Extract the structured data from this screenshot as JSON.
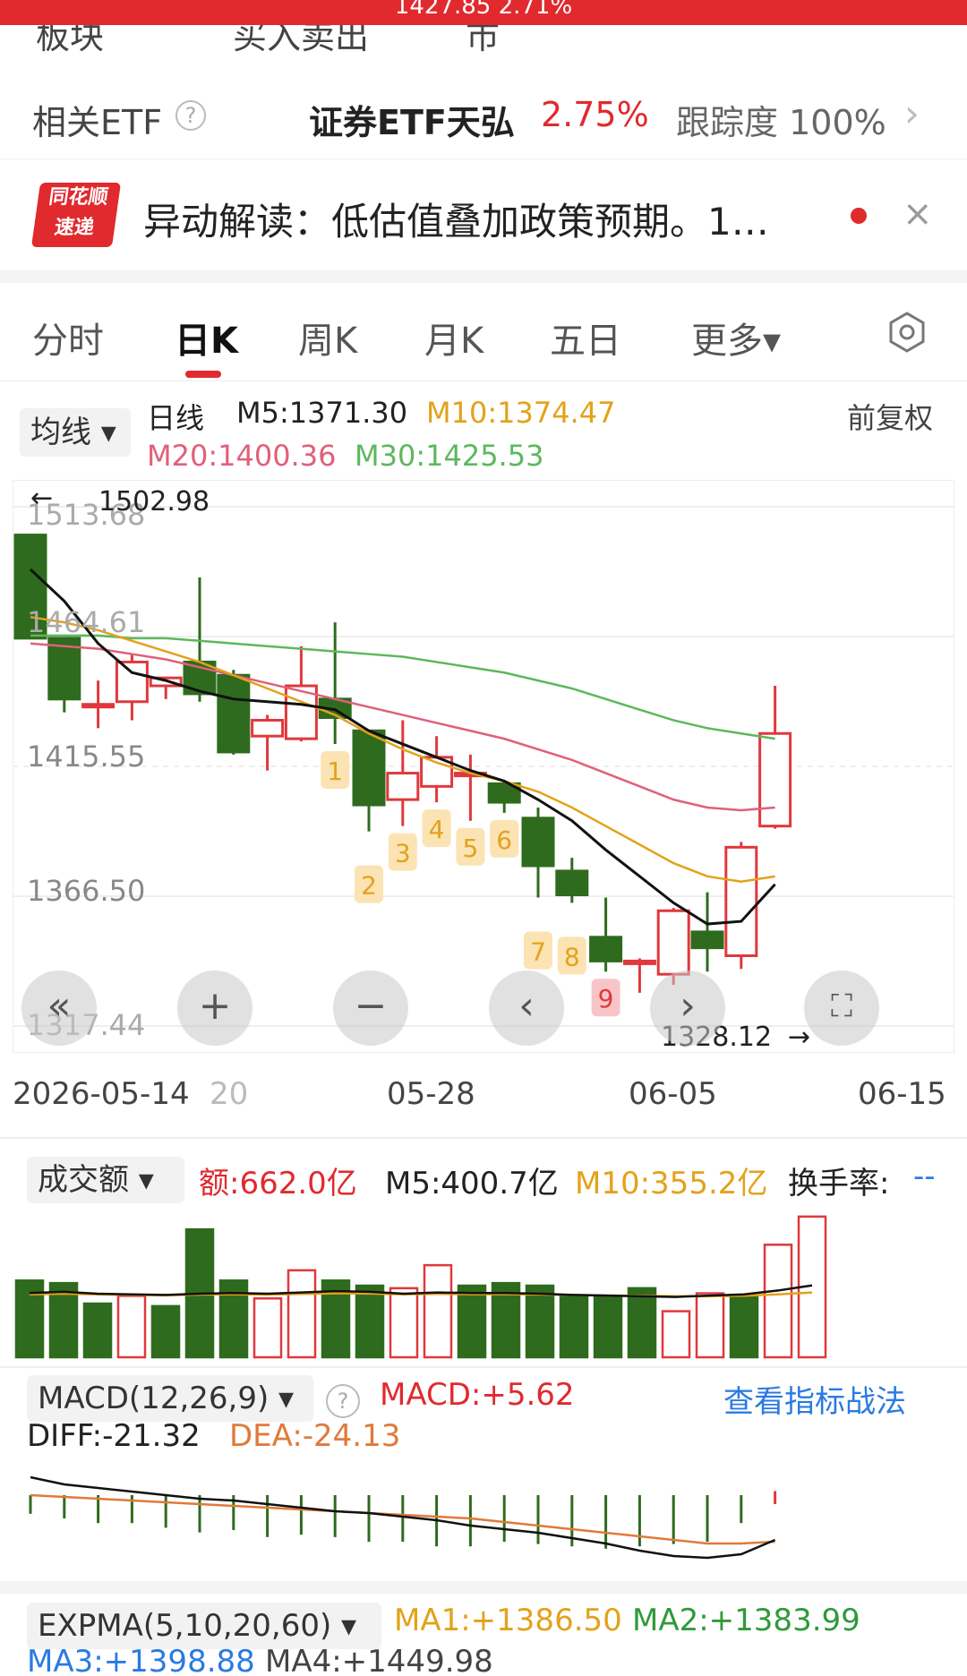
{
  "top": {
    "price_line": "1427.85 2.71%",
    "cut_labels": [
      "板块",
      "买入卖出",
      "市"
    ]
  },
  "etf": {
    "label": "相关ETF",
    "help": "?",
    "name": "证券ETF天弘",
    "pct": "2.75%",
    "track_label": "跟踪度",
    "track_value": "100%",
    "chevron": "›"
  },
  "news": {
    "logo_top": "同花顺",
    "logo_bottom": "速递",
    "text": "异动解读：低估值叠加政策预期。1…",
    "close": "×"
  },
  "tabs": [
    "分时",
    "日K",
    "周K",
    "月K",
    "五日",
    "更多▾"
  ],
  "ma": {
    "selector": "均线 ▾",
    "period": "日线",
    "m5": "M5:1371.30",
    "m10": "M10:1374.47",
    "m20": "M20:1400.36",
    "m30": "M30:1425.53",
    "adjust": "前复权"
  },
  "axis": {
    "y1": "1513.68",
    "y2": "1464.61",
    "y3": "1415.55",
    "y4": "1366.50",
    "y5": "1317.44",
    "high": "1502.98",
    "low": "1328.12",
    "dates": [
      "2026-05-14",
      "20",
      "05-28",
      "06-05",
      "06-15"
    ]
  },
  "markers": [
    "1",
    "2",
    "3",
    "4",
    "5",
    "6",
    "7",
    "8",
    "9"
  ],
  "volume": {
    "selector": "成交额 ▾",
    "amount": "额:662.0亿",
    "m5": "M5:400.7亿",
    "m10": "M10:355.2亿",
    "turnover_label": "换手率:",
    "turnover_value": "--"
  },
  "macd": {
    "selector": "MACD(12,26,9) ▾",
    "help": "?",
    "macd": "MACD:+5.62",
    "link": "查看指标战法",
    "diff": "DIFF:-21.32",
    "dea": "DEA:-24.13"
  },
  "expma": {
    "selector": "EXPMA(5,10,20,60) ▾",
    "ma1": "MA1:+1386.50",
    "ma2": "MA2:+1383.99",
    "ma3": "MA3:+1398.88",
    "ma4": "MA4:+1449.98"
  },
  "controls": [
    "«",
    "+",
    "−",
    "‹",
    "›"
  ],
  "colors": {
    "up": "#e0383c",
    "down": "#2f6b1e",
    "m5": "#111111",
    "m10": "#e3a21a",
    "m20": "#e0607a",
    "m30": "#5cb85c",
    "accent": "#e02a2e",
    "link": "#2a7ae2"
  },
  "chart_data": {
    "type": "candlestick",
    "ylim": [
      1317.44,
      1513.68
    ],
    "candles": [
      {
        "o": 1503,
        "h": 1503,
        "l": 1464,
        "c": 1464
      },
      {
        "o": 1464,
        "h": 1464,
        "l": 1436,
        "c": 1441
      },
      {
        "o": 1439,
        "h": 1448,
        "l": 1430,
        "c": 1439
      },
      {
        "o": 1440,
        "h": 1458,
        "l": 1433,
        "c": 1455
      },
      {
        "o": 1446,
        "h": 1448,
        "l": 1441,
        "c": 1449
      },
      {
        "o": 1455,
        "h": 1487,
        "l": 1440,
        "c": 1443
      },
      {
        "o": 1450,
        "h": 1452,
        "l": 1420,
        "c": 1421
      },
      {
        "o": 1427,
        "h": 1435,
        "l": 1414,
        "c": 1433
      },
      {
        "o": 1426,
        "h": 1461,
        "l": 1425,
        "c": 1446
      },
      {
        "o": 1441,
        "h": 1470,
        "l": 1424,
        "c": 1434
      },
      {
        "o": 1429,
        "h": 1429,
        "l": 1391,
        "c": 1401
      },
      {
        "o": 1403,
        "h": 1433,
        "l": 1393,
        "c": 1413
      },
      {
        "o": 1408,
        "h": 1427,
        "l": 1402,
        "c": 1419
      },
      {
        "o": 1413,
        "h": 1420,
        "l": 1395,
        "c": 1413
      },
      {
        "o": 1409,
        "h": 1410,
        "l": 1398,
        "c": 1402
      },
      {
        "o": 1396,
        "h": 1400,
        "l": 1366,
        "c": 1378
      },
      {
        "o": 1376,
        "h": 1381,
        "l": 1364,
        "c": 1367
      },
      {
        "o": 1351,
        "h": 1366,
        "l": 1338,
        "c": 1342
      },
      {
        "o": 1341,
        "h": 1343,
        "l": 1330,
        "c": 1342
      },
      {
        "o": 1337,
        "h": 1362,
        "l": 1333,
        "c": 1361
      },
      {
        "o": 1353,
        "h": 1368,
        "l": 1338,
        "c": 1347
      },
      {
        "o": 1344,
        "h": 1387,
        "l": 1339,
        "c": 1385
      },
      {
        "o": 1393,
        "h": 1446,
        "l": 1392,
        "c": 1428
      }
    ],
    "m5": [
      1490,
      1478,
      1462,
      1451,
      1448,
      1444,
      1441,
      1440,
      1439,
      1437,
      1429,
      1424,
      1419,
      1414,
      1410,
      1403,
      1395,
      1384,
      1374,
      1364,
      1356,
      1357,
      1371
    ],
    "m10": [
      1472,
      1470,
      1467,
      1463,
      1459,
      1455,
      1450,
      1445,
      1440,
      1435,
      1428,
      1422,
      1417,
      1413,
      1410,
      1406,
      1400,
      1393,
      1386,
      1379,
      1374,
      1372,
      1374
    ],
    "m20": [
      1462,
      1461,
      1460,
      1458,
      1456,
      1453,
      1450,
      1447,
      1444,
      1441,
      1438,
      1435,
      1432,
      1429,
      1426,
      1422,
      1418,
      1413,
      1408,
      1403,
      1400,
      1399,
      1400
    ],
    "m30": [
      1465,
      1465,
      1465,
      1464,
      1464,
      1463,
      1462,
      1461,
      1460,
      1459,
      1458,
      1457,
      1455,
      1453,
      1451,
      1448,
      1445,
      1441,
      1437,
      1433,
      1430,
      1428,
      1426
    ],
    "volume": [
      300,
      290,
      210,
      240,
      200,
      500,
      300,
      230,
      340,
      300,
      280,
      270,
      360,
      280,
      290,
      280,
      240,
      240,
      270,
      180,
      250,
      240,
      440,
      550
    ],
    "volume_up": [
      false,
      false,
      false,
      true,
      false,
      false,
      false,
      true,
      true,
      false,
      false,
      true,
      true,
      false,
      false,
      false,
      false,
      false,
      false,
      true,
      true,
      false,
      true,
      true
    ],
    "macd_bars": [
      -8,
      -10,
      -12,
      -12,
      -14,
      -16,
      -15,
      -18,
      -17,
      -18,
      -20,
      -20,
      -22,
      -22,
      -20,
      -21,
      -22,
      -23,
      -22,
      -21,
      -20,
      -12,
      5.62
    ]
  }
}
